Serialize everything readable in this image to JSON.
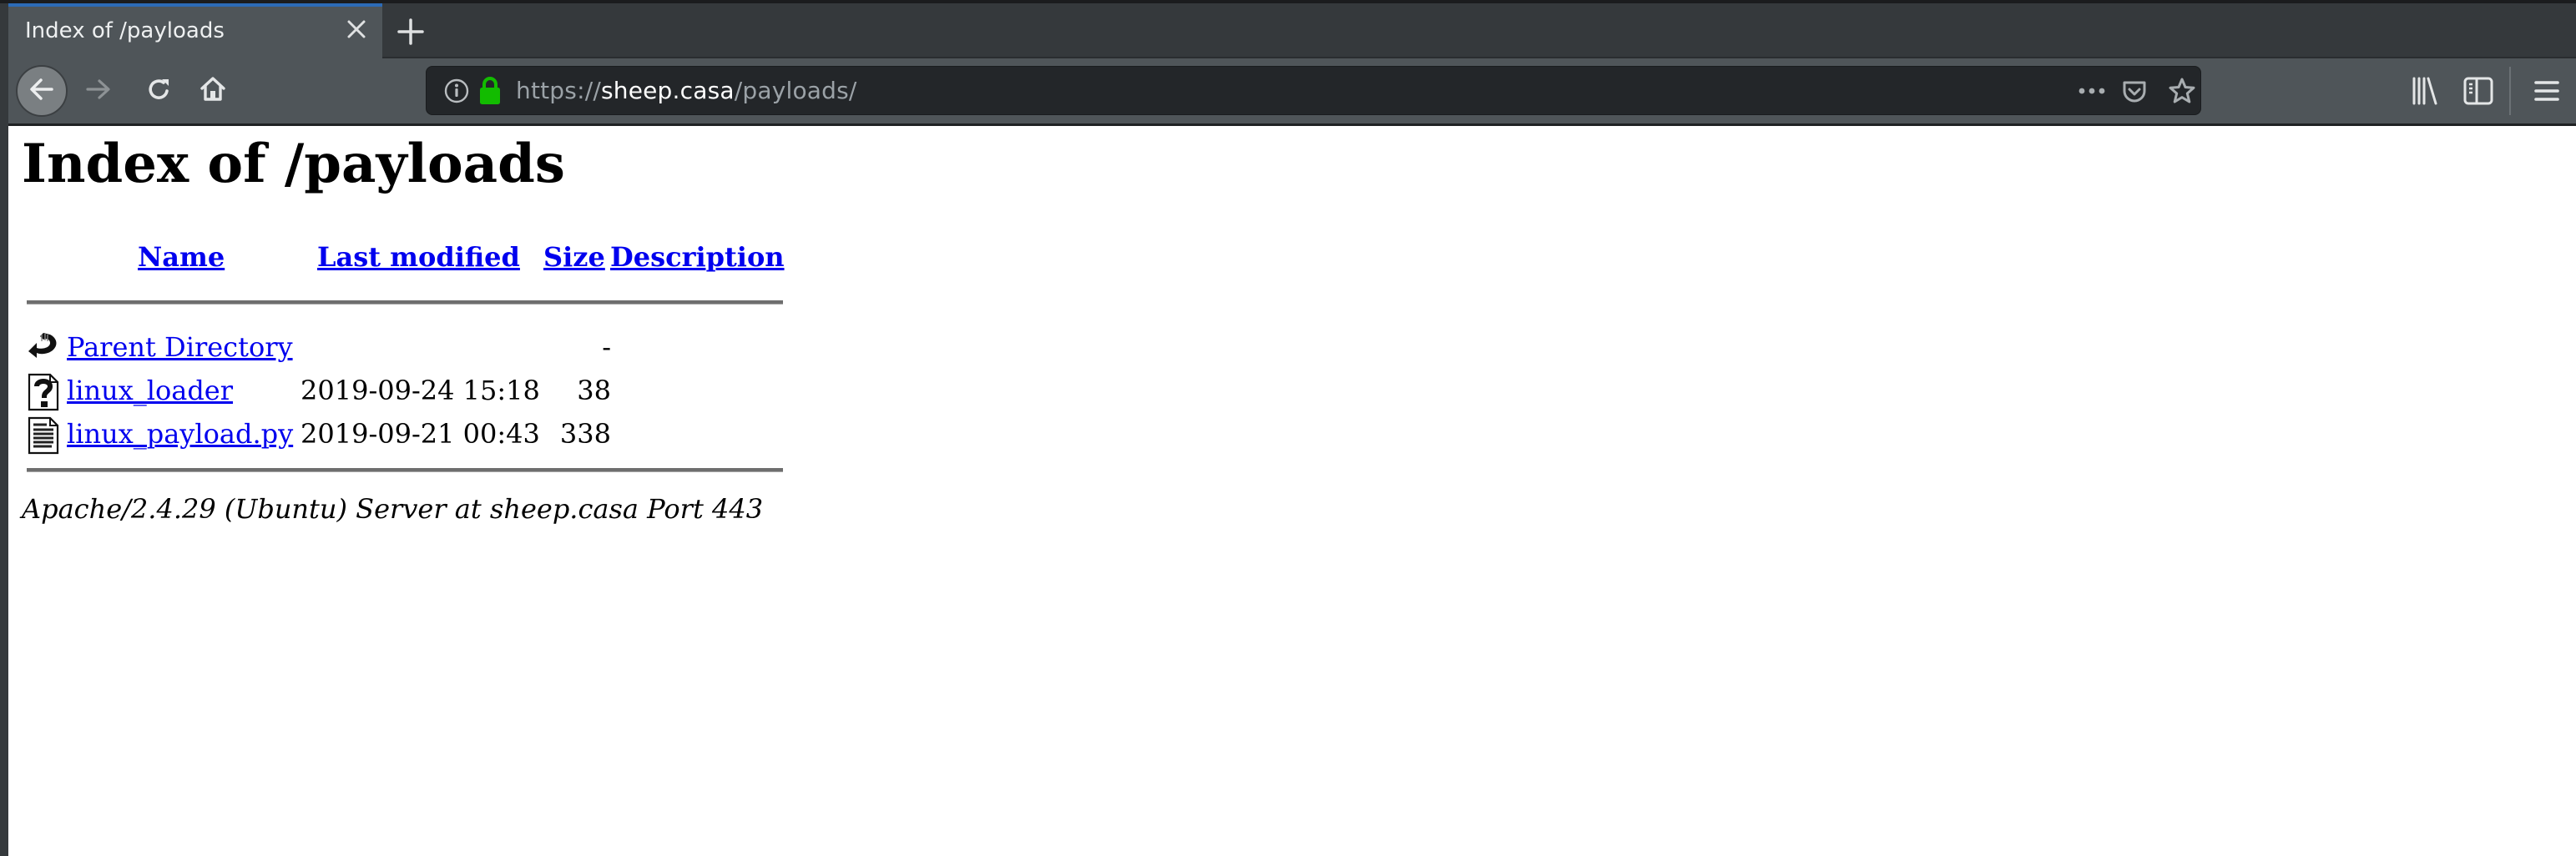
{
  "browser": {
    "tab": {
      "title": "Index of /payloads",
      "close_icon": "close-icon"
    },
    "new_tab_icon": "plus-icon",
    "nav": {
      "back_icon": "arrow-left-icon",
      "forward_icon": "arrow-right-icon",
      "reload_icon": "reload-icon",
      "home_icon": "home-icon"
    },
    "urlbar": {
      "scheme": "https://",
      "host": "sheep.casa",
      "path": "/payloads/",
      "info_icon": "info-icon",
      "lock_icon": "lock-icon",
      "page_actions_icon": "ellipsis-icon",
      "pocket_icon": "pocket-icon",
      "bookmark_icon": "star-icon"
    },
    "toolbar": {
      "library_icon": "library-icon",
      "sidebar_icon": "sidebar-icon",
      "menu_icon": "hamburger-menu-icon"
    },
    "colors": {
      "accent": "#2c6bb6",
      "lock": "#12bc00",
      "link": "#0000ee"
    }
  },
  "page": {
    "heading": "Index of /payloads",
    "columns": [
      "Name",
      "Last modified",
      "Size",
      "Description"
    ],
    "rows": [
      {
        "icon": "back-folder-icon",
        "name": "Parent Directory",
        "modified": "",
        "size": "-",
        "description": ""
      },
      {
        "icon": "unknown-file-icon",
        "name": "linux_loader",
        "modified": "2019-09-24 15:18",
        "size": "38",
        "description": ""
      },
      {
        "icon": "text-file-icon",
        "name": "linux_payload.py",
        "modified": "2019-09-21 00:43",
        "size": "338",
        "description": ""
      }
    ],
    "footer": "Apache/2.4.29 (Ubuntu) Server at sheep.casa Port 443"
  }
}
